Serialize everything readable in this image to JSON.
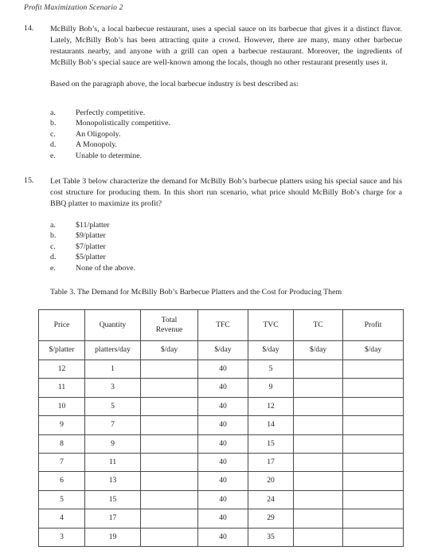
{
  "document": {
    "running_head": "Profit Maximization Scenario 2"
  },
  "questions": [
    {
      "number": "14.",
      "stem": "McBilly Bob’s, a local barbecue restaurant, uses a special sauce on its barbecue that gives it a distinct flavor.  Lately, McBilly Bob’s has been attracting quite a crowd.  However, there are many, many other barbecue restaurants nearby, and anyone with a grill can open a barbecue restaurant. Moreover, the ingredients of McBilly Bob’s special sauce are well-known among the locals, though no other restaurant presently uses it.",
      "stem_follow": "Based on the paragraph above, the local barbecue industry is best described as:",
      "options": [
        {
          "letter": "a.",
          "text": "Perfectly competitive."
        },
        {
          "letter": "b.",
          "text": "Monopolistically competitive."
        },
        {
          "letter": "c.",
          "text": "An Oligopoly."
        },
        {
          "letter": "d.",
          "text": "A Monopoly."
        },
        {
          "letter": "e.",
          "text": "Unable to determine."
        }
      ]
    },
    {
      "number": "15.",
      "stem": "Let Table 3 below characterize the demand for McBilly Bob’s barbecue platters using his special sauce and his cost structure for producing them.  In this short run scenario, what price should McBilly Bob’s charge for a BBQ platter to maximize its profit?",
      "stem_follow": "",
      "options": [
        {
          "letter": "a.",
          "text": "$11/platter"
        },
        {
          "letter": "b.",
          "text": "$9/platter"
        },
        {
          "letter": "c.",
          "text": "$7/platter"
        },
        {
          "letter": "d.",
          "text": "$5/platter"
        },
        {
          "letter": "e.",
          "text": "None of the above."
        }
      ]
    }
  ],
  "table": {
    "caption": "Table 3.  The Demand for McBilly Bob’s Barbecue Platters and the Cost for Producing Them",
    "headers": [
      {
        "line1": "Price",
        "line2": ""
      },
      {
        "line1": "Quantity",
        "line2": ""
      },
      {
        "line1": "Total",
        "line2": "Revenue"
      },
      {
        "line1": "TFC",
        "line2": ""
      },
      {
        "line1": "TVC",
        "line2": ""
      },
      {
        "line1": "TC",
        "line2": ""
      },
      {
        "line1": "Profit",
        "line2": ""
      }
    ],
    "units": [
      "$/platter",
      "platters/day",
      "$/day",
      "$/day",
      "$/day",
      "$/day",
      "$/day"
    ],
    "rows": [
      [
        "12",
        "1",
        "",
        "40",
        "5",
        "",
        ""
      ],
      [
        "11",
        "3",
        "",
        "40",
        "9",
        "",
        ""
      ],
      [
        "10",
        "5",
        "",
        "40",
        "12",
        "",
        ""
      ],
      [
        "9",
        "7",
        "",
        "40",
        "14",
        "",
        ""
      ],
      [
        "8",
        "9",
        "",
        "40",
        "15",
        "",
        ""
      ],
      [
        "7",
        "11",
        "",
        "40",
        "17",
        "",
        ""
      ],
      [
        "6",
        "13",
        "",
        "40",
        "20",
        "",
        ""
      ],
      [
        "5",
        "15",
        "",
        "40",
        "24",
        "",
        ""
      ],
      [
        "4",
        "17",
        "",
        "40",
        "29",
        "",
        ""
      ],
      [
        "3",
        "19",
        "",
        "40",
        "35",
        "",
        ""
      ]
    ]
  }
}
